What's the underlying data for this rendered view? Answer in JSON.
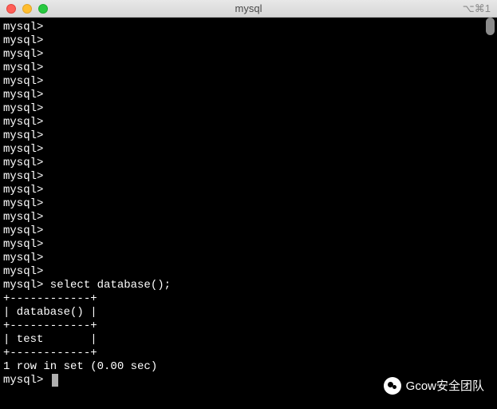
{
  "window": {
    "title": "mysql",
    "shortcut": "⌥⌘1"
  },
  "terminal": {
    "prompt": "mysql>",
    "empty_prompt_count": 19,
    "query_line": "mysql> select database();",
    "result": {
      "border": "+------------+",
      "header": "| database() |",
      "row": "| test       |",
      "status": "1 row in set (0.00 sec)"
    },
    "chart_data": {
      "type": "table",
      "columns": [
        "database()"
      ],
      "rows": [
        [
          "test"
        ]
      ],
      "row_count": 1,
      "elapsed_sec": 0.0
    },
    "final_prompt": "mysql> "
  },
  "watermark": {
    "text": "Gcow安全团队"
  }
}
